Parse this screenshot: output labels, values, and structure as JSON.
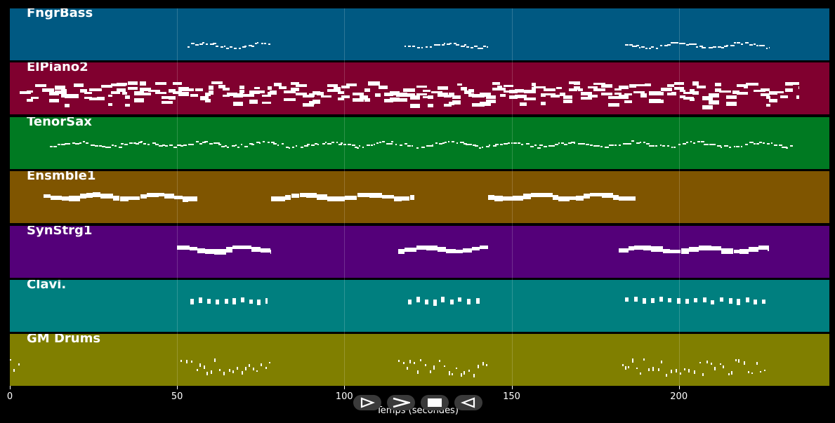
{
  "chart_data": {
    "type": "piano-roll",
    "xlabel": "Temps (secondes)",
    "xlim": [
      0,
      245
    ],
    "xticks": [
      0,
      50,
      100,
      150,
      200
    ],
    "tracks": [
      {
        "name": "FngrBass",
        "color": "#005982",
        "segments": [
          [
            53,
            78
          ],
          [
            118,
            143
          ],
          [
            184,
            227
          ]
        ],
        "density": "sparse-small",
        "pitch_center": 0.7
      },
      {
        "name": "ElPiano2",
        "color": "#80002f",
        "segments": [
          [
            3,
            236
          ]
        ],
        "density": "dense-chords",
        "pitch_center": 0.55
      },
      {
        "name": "TenorSax",
        "color": "#007a22",
        "segments": [
          [
            12,
            234
          ]
        ],
        "density": "sparse-small",
        "pitch_center": 0.52
      },
      {
        "name": "Ensmble1",
        "color": "#7f5500",
        "segments": [
          [
            10,
            56
          ],
          [
            78,
            121
          ],
          [
            143,
            187
          ]
        ],
        "density": "blocks",
        "pitch_center": 0.45
      },
      {
        "name": "SynStrg1",
        "color": "#540079",
        "segments": [
          [
            50,
            78
          ],
          [
            116,
            143
          ],
          [
            182,
            227
          ]
        ],
        "density": "blocks",
        "pitch_center": 0.42
      },
      {
        "name": "Clavi.",
        "color": "#007f7f",
        "segments": [
          [
            54,
            77
          ],
          [
            119,
            142
          ],
          [
            184,
            227
          ]
        ],
        "density": "staccato",
        "pitch_center": 0.4
      },
      {
        "name": "GM Drums",
        "color": "#807f00",
        "segments": [
          [
            0,
            3
          ],
          [
            51,
            78
          ],
          [
            116,
            143
          ],
          [
            183,
            227
          ]
        ],
        "density": "drums",
        "pitch_center": 0.6
      }
    ]
  },
  "controls": [
    {
      "name": "play-forward-button",
      "glyph": "play"
    },
    {
      "name": "fast-forward-button",
      "glyph": "ffwd"
    },
    {
      "name": "stop-button",
      "glyph": "stop"
    },
    {
      "name": "rewind-button",
      "glyph": "rewind"
    }
  ]
}
